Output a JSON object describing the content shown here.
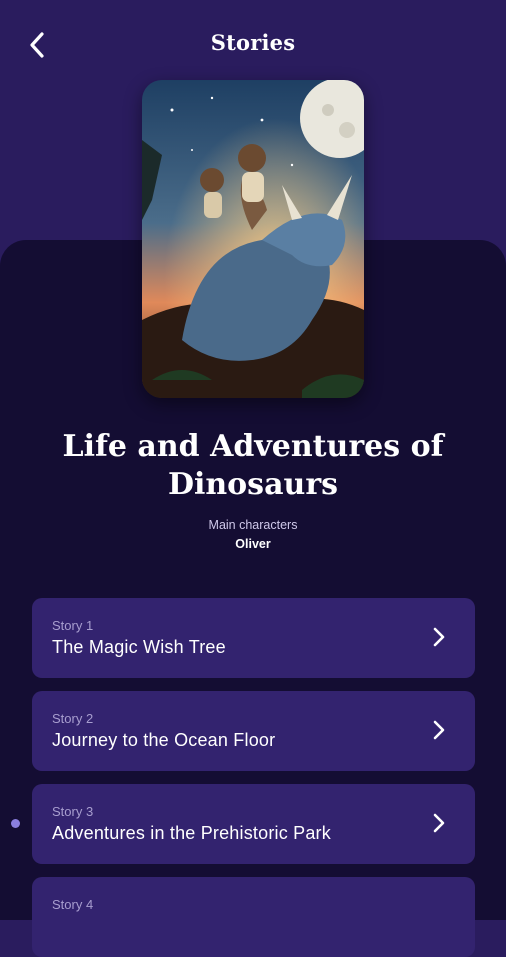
{
  "header": {
    "title": "Stories",
    "back_icon": "chevron-left-icon"
  },
  "book": {
    "cover_icon": "dinosaur-cover-illustration",
    "title": "Life and Adventures of Dinosaurs",
    "main_characters_label": "Main characters",
    "main_characters": "Oliver"
  },
  "stories": [
    {
      "number": "Story 1",
      "title": "The Magic Wish Tree"
    },
    {
      "number": "Story 2",
      "title": "Journey to the Ocean Floor"
    },
    {
      "number": "Story 3",
      "title": "Adventures in the Prehistoric Park"
    },
    {
      "number": "Story 4",
      "title": ""
    }
  ],
  "colors": {
    "background": "#2a1c5e",
    "panel": "#140d33",
    "card": "#33236f",
    "accent_dot": "#8b7fe0"
  }
}
